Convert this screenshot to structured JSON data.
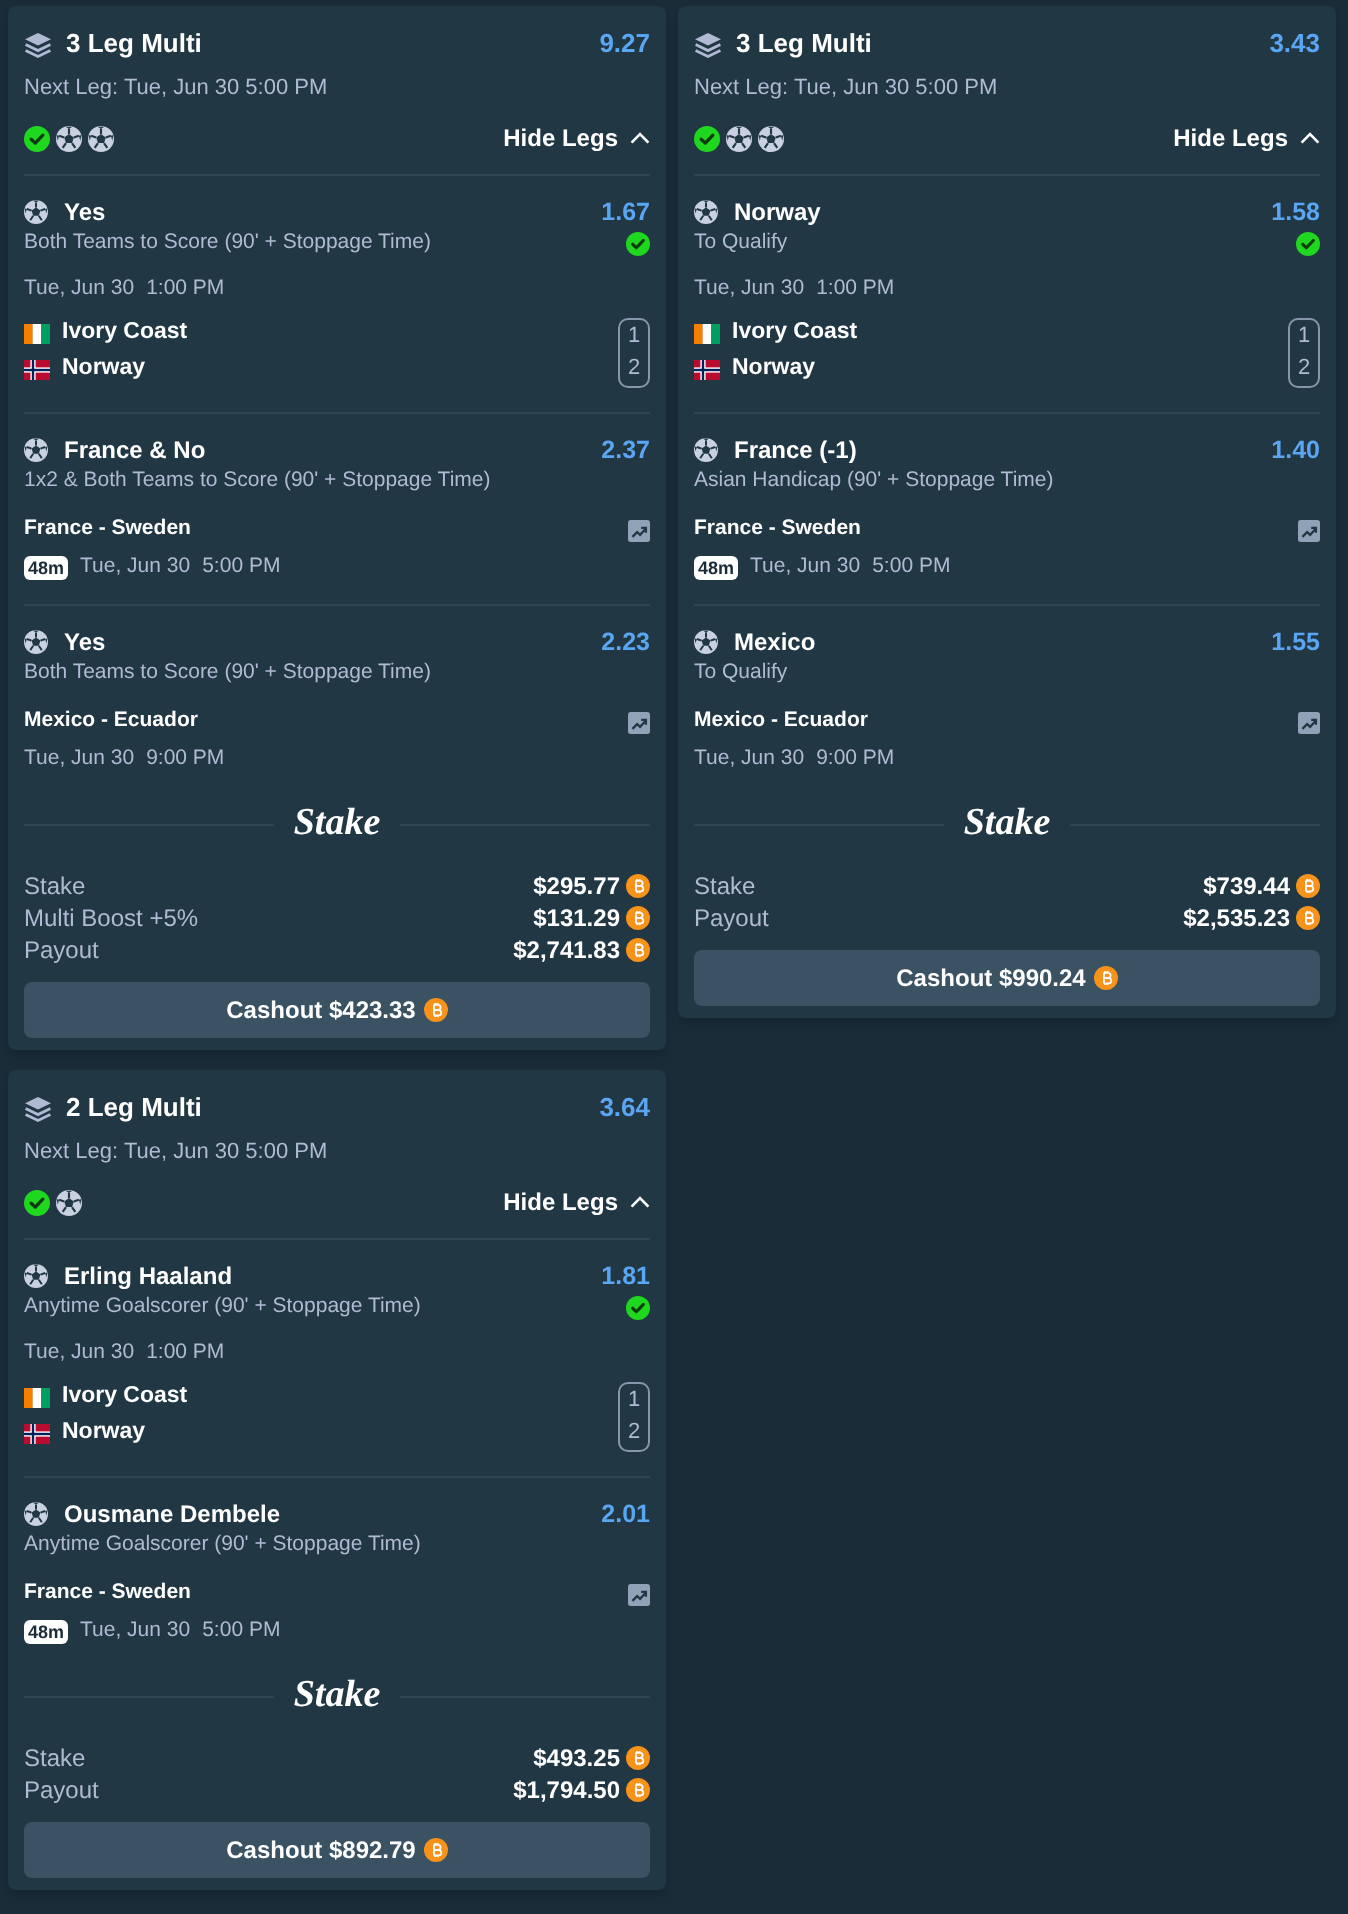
{
  "bets": [
    {
      "title": "3 Leg Multi",
      "odds": "9.27",
      "next_leg": "Next Leg: Tue, Jun 30 5:00 PM",
      "toggle": {
        "label": "Hide Legs",
        "expanded": true
      },
      "legs": [
        {
          "kind": "teams",
          "selection": "Yes",
          "market": "Both Teams to Score (90' + Stoppage Time)",
          "odds": "1.67",
          "won": true,
          "date": "Tue, Jun 30",
          "time": "1:00 PM",
          "teams": [
            {
              "kind": "tricolour",
              "name": "Ivory Coast",
              "score": "1"
            },
            {
              "kind": "nordic-cross",
              "name": "Norway",
              "score": "2"
            }
          ]
        },
        {
          "kind": "match",
          "selection": "France & No",
          "market": "1x2 & Both Teams to Score (90' + Stoppage Time)",
          "odds": "2.37",
          "won": false,
          "match": "France - Sweden",
          "countdown": "48m",
          "date": "Tue, Jun 30",
          "time": "5:00 PM"
        },
        {
          "kind": "match",
          "selection": "Yes",
          "market": "Both Teams to Score (90' + Stoppage Time)",
          "odds": "2.23",
          "won": false,
          "match": "Mexico - Ecuador",
          "date": "Tue, Jun 30",
          "time": "9:00 PM"
        }
      ],
      "logo": "Stake",
      "summary": [
        {
          "label": "Stake",
          "value": "$295.77"
        },
        {
          "label": "Multi Boost +5%",
          "value": "$131.29"
        },
        {
          "label": "Payout",
          "value": "$2,741.83"
        }
      ],
      "cashout": "Cashout $423.33"
    },
    {
      "title": "3 Leg Multi",
      "odds": "3.43",
      "next_leg": "Next Leg: Tue, Jun 30 5:00 PM",
      "toggle": {
        "label": "Hide Legs",
        "expanded": true
      },
      "legs": [
        {
          "kind": "teams",
          "selection": "Norway",
          "market": "To Qualify",
          "odds": "1.58",
          "won": true,
          "date": "Tue, Jun 30",
          "time": "1:00 PM",
          "teams": [
            {
              "kind": "tricolour",
              "name": "Ivory Coast",
              "score": "1"
            },
            {
              "kind": "nordic-cross",
              "name": "Norway",
              "score": "2"
            }
          ]
        },
        {
          "kind": "match",
          "selection": "France (-1)",
          "market": "Asian Handicap (90' + Stoppage Time)",
          "odds": "1.40",
          "won": false,
          "match": "France - Sweden",
          "countdown": "48m",
          "date": "Tue, Jun 30",
          "time": "5:00 PM"
        },
        {
          "kind": "match",
          "selection": "Mexico",
          "market": "To Qualify",
          "odds": "1.55",
          "won": false,
          "match": "Mexico - Ecuador",
          "date": "Tue, Jun 30",
          "time": "9:00 PM"
        }
      ],
      "logo": "Stake",
      "summary": [
        {
          "label": "Stake",
          "value": "$739.44"
        },
        {
          "label": "Payout",
          "value": "$2,535.23"
        }
      ],
      "cashout": "Cashout $990.24"
    },
    {
      "title": "2 Leg Multi",
      "odds": "3.64",
      "next_leg": "Next Leg: Tue, Jun 30 5:00 PM",
      "toggle": {
        "label": "Hide Legs",
        "expanded": true
      },
      "legs": [
        {
          "kind": "teams",
          "selection": "Erling Haaland",
          "market": "Anytime Goalscorer (90' + Stoppage Time)",
          "odds": "1.81",
          "won": true,
          "date": "Tue, Jun 30",
          "time": "1:00 PM",
          "teams": [
            {
              "kind": "tricolour",
              "name": "Ivory Coast",
              "score": "1"
            },
            {
              "kind": "nordic-cross",
              "name": "Norway",
              "score": "2"
            }
          ]
        },
        {
          "kind": "match",
          "selection": "Ousmane Dembele",
          "market": "Anytime Goalscorer (90' + Stoppage Time)",
          "odds": "2.01",
          "won": false,
          "match": "France - Sweden",
          "countdown": "48m",
          "date": "Tue, Jun 30",
          "time": "5:00 PM"
        }
      ],
      "logo": "Stake",
      "summary": [
        {
          "label": "Stake",
          "value": "$493.25"
        },
        {
          "label": "Payout",
          "value": "$1,794.50"
        }
      ],
      "cashout": "Cashout $892.79"
    }
  ]
}
